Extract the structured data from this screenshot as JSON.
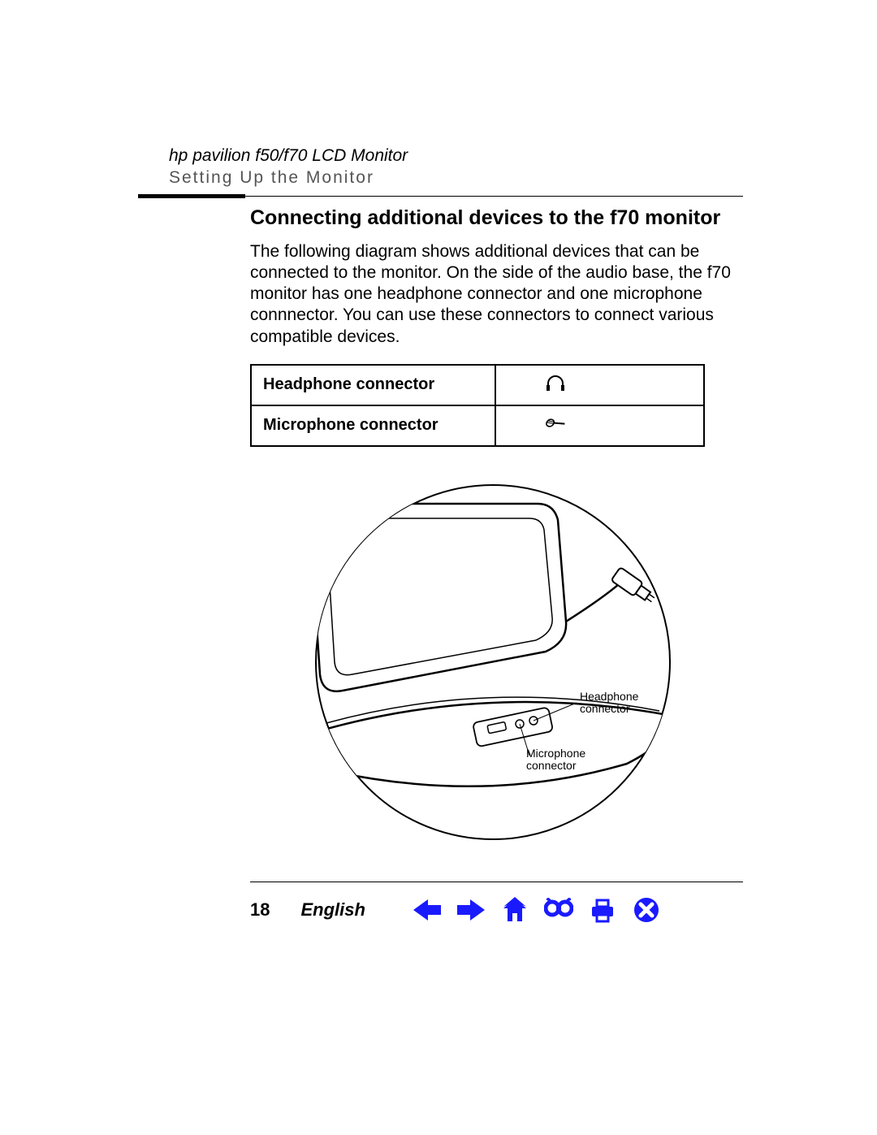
{
  "header": {
    "line1": "hp pavilion f50/f70 LCD Monitor",
    "line2": "Setting Up the Monitor"
  },
  "section_title": "Connecting additional devices to the f70 monitor",
  "body_text": "The following diagram shows additional devices that can be connected to the monitor. On the side of the audio base, the f70 monitor has one headphone connector and one microphone connnector. You can use these connectors to connect various compatible devices.",
  "table": {
    "rows": [
      {
        "label": "Headphone connector",
        "icon": "headphone"
      },
      {
        "label": "Microphone connector",
        "icon": "microphone"
      }
    ]
  },
  "diagram": {
    "callouts": {
      "headphone": "Headphone\nconnector",
      "microphone": "Microphone\nconnector"
    }
  },
  "footer": {
    "page": "18",
    "language": "English"
  },
  "nav_icons": [
    "arrow-left",
    "arrow-right",
    "home",
    "binoculars",
    "printer",
    "close"
  ]
}
